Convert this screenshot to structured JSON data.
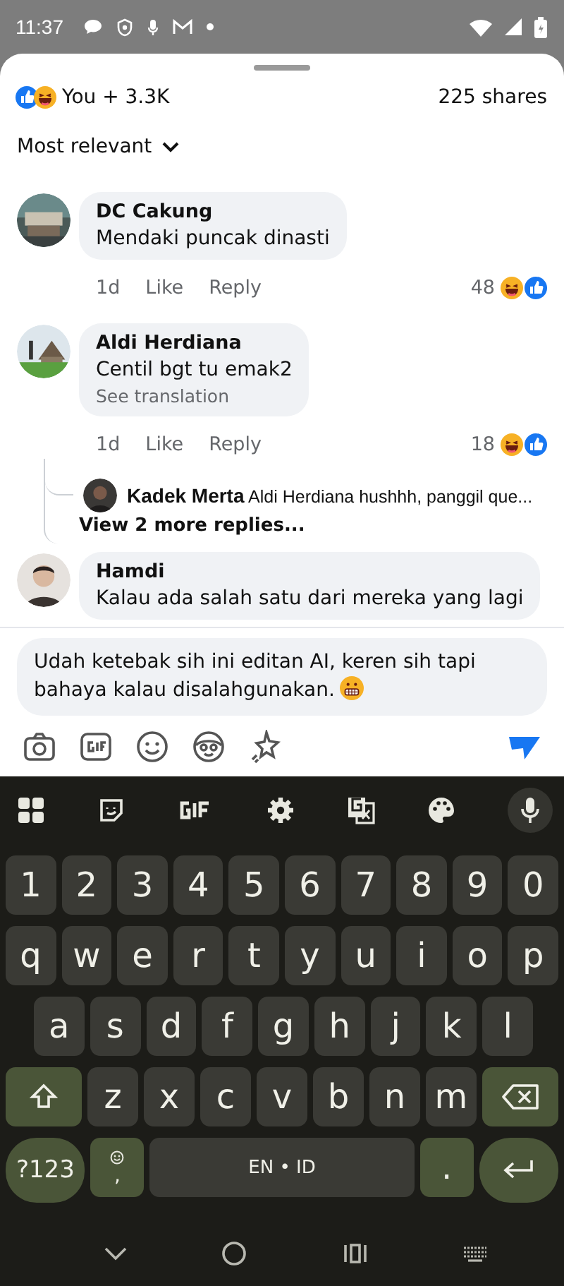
{
  "status_bar": {
    "time": "11:37"
  },
  "reactions_summary": {
    "count": "You + 3.3K",
    "shares": "225 shares"
  },
  "sort": {
    "label": "Most relevant"
  },
  "comments": [
    {
      "author": "DC Cakung",
      "text": "Mendaki puncak dinasti",
      "time": "1d",
      "like": "Like",
      "reply": "Reply",
      "reaction_count": "48"
    },
    {
      "author": "Aldi Herdiana",
      "text": "Centil bgt tu emak2",
      "see_translation": "See translation",
      "time": "1d",
      "like": "Like",
      "reply": "Reply",
      "reaction_count": "18",
      "replies": [
        {
          "author": "Kadek Merta",
          "text": "Aldi Herdiana hushhh, panggil que..."
        }
      ],
      "more_replies": "View 2 more replies..."
    },
    {
      "author": "Hamdi",
      "text": "Kalau ada salah satu dari mereka yang lagi"
    }
  ],
  "composer": {
    "value": "Udah ketebak sih ini editan AI, keren sih tapi bahaya kalau disalahgunakan."
  },
  "keyboard": {
    "rows": [
      {
        "keys": [
          {
            "kind": "char",
            "label": "1"
          },
          {
            "kind": "char",
            "label": "2"
          },
          {
            "kind": "char",
            "label": "3"
          },
          {
            "kind": "char",
            "label": "4"
          },
          {
            "kind": "char",
            "label": "5"
          },
          {
            "kind": "char",
            "label": "6"
          },
          {
            "kind": "char",
            "label": "7"
          },
          {
            "kind": "char",
            "label": "8"
          },
          {
            "kind": "char",
            "label": "9"
          },
          {
            "kind": "char",
            "label": "0"
          }
        ]
      },
      {
        "keys": [
          {
            "kind": "char",
            "label": "q"
          },
          {
            "kind": "char",
            "label": "w"
          },
          {
            "kind": "char",
            "label": "e"
          },
          {
            "kind": "char",
            "label": "r"
          },
          {
            "kind": "char",
            "label": "t"
          },
          {
            "kind": "char",
            "label": "y"
          },
          {
            "kind": "char",
            "label": "u"
          },
          {
            "kind": "char",
            "label": "i"
          },
          {
            "kind": "char",
            "label": "o"
          },
          {
            "kind": "char",
            "label": "p"
          }
        ]
      },
      {
        "keys": [
          {
            "kind": "char",
            "label": "a"
          },
          {
            "kind": "char",
            "label": "s"
          },
          {
            "kind": "char",
            "label": "d"
          },
          {
            "kind": "char",
            "label": "f"
          },
          {
            "kind": "char",
            "label": "g"
          },
          {
            "kind": "char",
            "label": "h"
          },
          {
            "kind": "char",
            "label": "j"
          },
          {
            "kind": "char",
            "label": "k"
          },
          {
            "kind": "char",
            "label": "l"
          }
        ]
      },
      {
        "keys": [
          {
            "kind": "shift"
          },
          {
            "kind": "char",
            "label": "z"
          },
          {
            "kind": "char",
            "label": "x"
          },
          {
            "kind": "char",
            "label": "c"
          },
          {
            "kind": "char",
            "label": "v"
          },
          {
            "kind": "char",
            "label": "b"
          },
          {
            "kind": "char",
            "label": "n"
          },
          {
            "kind": "char",
            "label": "m"
          },
          {
            "kind": "backspace"
          }
        ]
      },
      {
        "keys": [
          {
            "kind": "symbols",
            "label": "?123"
          },
          {
            "kind": "emoji",
            "label": ","
          },
          {
            "kind": "space",
            "label": "EN • ID"
          },
          {
            "kind": "period",
            "label": "."
          },
          {
            "kind": "enter"
          }
        ]
      }
    ]
  }
}
